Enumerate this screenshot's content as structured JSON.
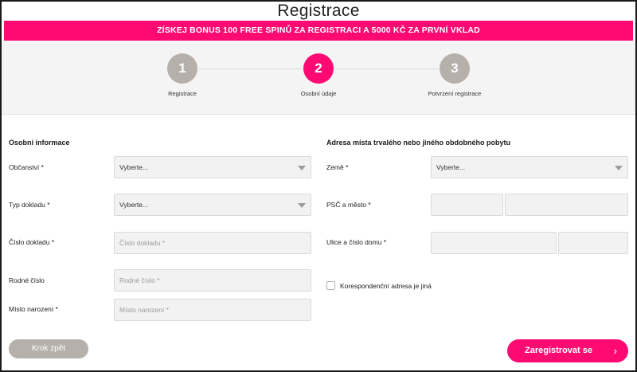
{
  "page": {
    "title": "Registrace"
  },
  "banner": {
    "text": "ZÍSKEJ BONUS 100 FREE SPINŮ ZA REGISTRACI A 5000 KČ ZA PRVNÍ VKLAD"
  },
  "steps": [
    {
      "number": "1",
      "label": "Registrace",
      "active": false
    },
    {
      "number": "2",
      "label": "Osobní údaje",
      "active": true
    },
    {
      "number": "3",
      "label": "Potvrzení registrace",
      "active": false
    }
  ],
  "colors": {
    "accent": "#ff0a73",
    "inactive": "#b5b0aa"
  },
  "personal": {
    "heading": "Osobní informace",
    "citizenship": {
      "label": "Občanství *",
      "value": "Vyberte..."
    },
    "doc_type": {
      "label": "Typ dokladu *",
      "value": "Vyberte..."
    },
    "doc_number": {
      "label": "Číslo dokladu *",
      "placeholder": "Číslo dokladu *"
    },
    "birth_number": {
      "label": "Rodné číslo",
      "placeholder": "Rodné číslo *"
    },
    "birth_place": {
      "label": "Místo narození *",
      "placeholder": "Místo narození *"
    }
  },
  "address": {
    "heading": "Adresa místa trvalého nebo jiného obdobného pobytu",
    "country": {
      "label": "Země *",
      "value": "Vyberte..."
    },
    "zip_city": {
      "label": "PSČ a město *"
    },
    "street": {
      "label": "Ulice a číslo domu *"
    },
    "correspondence": {
      "label": "Korespondenční adresa je jiná",
      "checked": false
    }
  },
  "buttons": {
    "back": "Krok zpět",
    "submit": "Zaregistrovat se",
    "submit_icon": "chevron-right-icon"
  }
}
